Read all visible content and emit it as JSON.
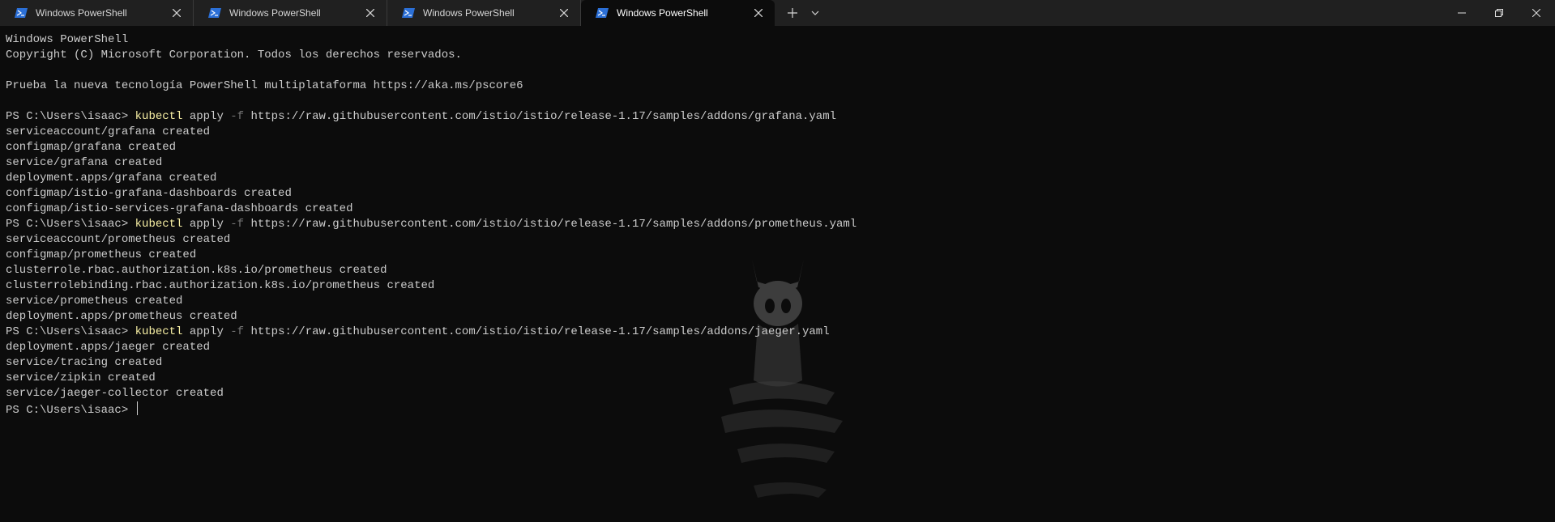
{
  "tabs": [
    {
      "label": "Windows PowerShell",
      "active": false
    },
    {
      "label": "Windows PowerShell",
      "active": false
    },
    {
      "label": "Windows PowerShell",
      "active": false
    },
    {
      "label": "Windows PowerShell",
      "active": true
    }
  ],
  "icons": {
    "tab": "powershell-icon",
    "close": "close-icon",
    "new_tab": "plus-icon",
    "dropdown": "chevron-down-icon",
    "minimize": "minimize-icon",
    "restore": "restore-icon",
    "window_close": "close-icon"
  },
  "colors": {
    "background": "#0c0c0c",
    "titlebar": "#202020",
    "text": "#cccccc",
    "command": "#f9f1a5",
    "parameter": "#767676"
  },
  "terminal": {
    "header": [
      "Windows PowerShell",
      "Copyright (C) Microsoft Corporation. Todos los derechos reservados.",
      "",
      "Prueba la nueva tecnología PowerShell multiplataforma https://aka.ms/pscore6",
      ""
    ],
    "prompt": "PS C:\\Users\\isaac> ",
    "blocks": [
      {
        "command": "kubectl",
        "verb": " apply ",
        "flag": "-f",
        "url": " https://raw.githubusercontent.com/istio/istio/release-1.17/samples/addons/grafana.yaml",
        "output": [
          "serviceaccount/grafana created",
          "configmap/grafana created",
          "service/grafana created",
          "deployment.apps/grafana created",
          "configmap/istio-grafana-dashboards created",
          "configmap/istio-services-grafana-dashboards created"
        ]
      },
      {
        "command": "kubectl",
        "verb": " apply ",
        "flag": "-f",
        "url": " https://raw.githubusercontent.com/istio/istio/release-1.17/samples/addons/prometheus.yaml",
        "output": [
          "serviceaccount/prometheus created",
          "configmap/prometheus created",
          "clusterrole.rbac.authorization.k8s.io/prometheus created",
          "clusterrolebinding.rbac.authorization.k8s.io/prometheus created",
          "service/prometheus created",
          "deployment.apps/prometheus created"
        ]
      },
      {
        "command": "kubectl",
        "verb": " apply ",
        "flag": "-f",
        "url": " https://raw.githubusercontent.com/istio/istio/release-1.17/samples/addons/jaeger.yaml",
        "output": [
          "deployment.apps/jaeger created",
          "service/tracing created",
          "service/zipkin created",
          "service/jaeger-collector created"
        ]
      }
    ]
  }
}
